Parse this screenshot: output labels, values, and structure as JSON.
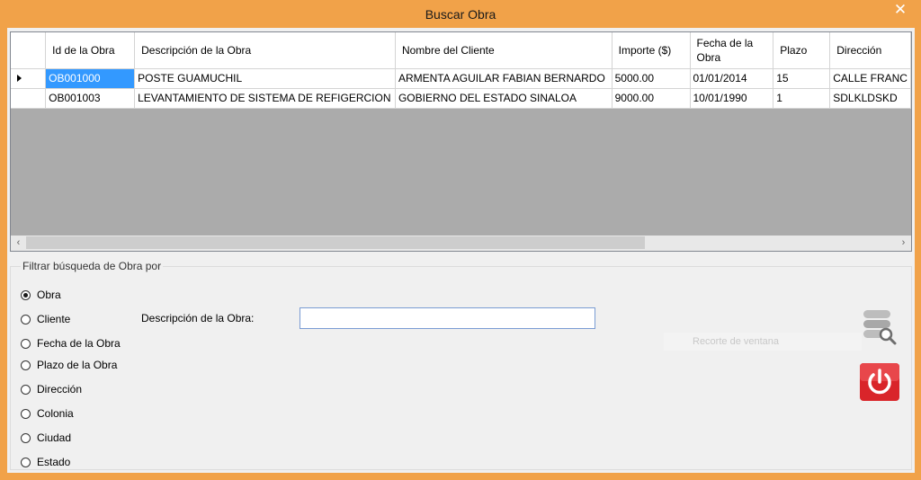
{
  "window": {
    "title": "Buscar Obra",
    "close_glyph": "✕"
  },
  "grid": {
    "columns": [
      "Id de la Obra",
      "Descripción de la Obra",
      "Nombre del Cliente",
      "Importe ($)",
      "Fecha de la Obra",
      "Plazo",
      "Dirección"
    ],
    "rows": [
      [
        "OB001000",
        "POSTE GUAMUCHIL",
        "ARMENTA AGUILAR FABIAN BERNARDO",
        "5000.00",
        "01/01/2014",
        "15",
        "CALLE FRANC"
      ],
      [
        "OB001003",
        "LEVANTAMIENTO DE SISTEMA DE REFIGERCION",
        "GOBIERNO DEL ESTADO SINALOA",
        "9000.00",
        "10/01/1990",
        "1",
        "SDLKLDSKD"
      ]
    ],
    "current_row_marker": "row-arrow-icon"
  },
  "filter": {
    "group_title": "Filtrar búsqueda de Obra por",
    "options": [
      "Obra",
      "Cliente",
      "Fecha de la Obra",
      "Plazo de la Obra",
      "Dirección",
      "Colonia",
      "Ciudad",
      "Estado"
    ],
    "selected": "Obra",
    "field_label": "Descripción de la Obra:",
    "field_value": "",
    "ghost_text": "Recorte de ventana"
  },
  "icons": {
    "search": "database-search-icon",
    "exit": "power-icon"
  },
  "colors": {
    "titlebar": "#f1a249",
    "selection": "#3399ff",
    "exit_button": "#d9252a"
  }
}
